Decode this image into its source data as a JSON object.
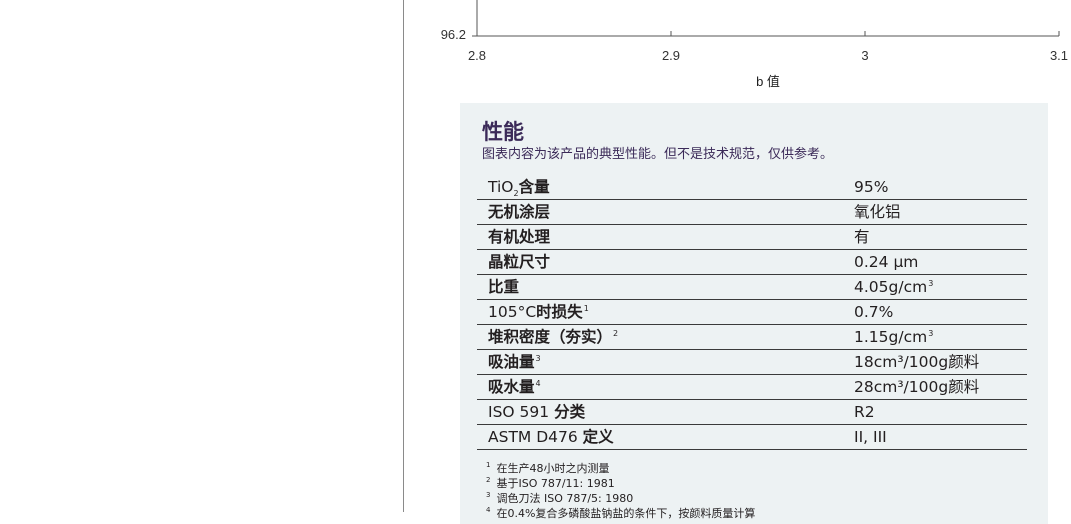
{
  "chart_data": {
    "type": "line",
    "xlabel": "b 值",
    "x_ticks": [
      "2.8",
      "2.9",
      "3",
      "3.1"
    ],
    "xlim": [
      2.8,
      3.1
    ],
    "y_ticks_visible": [
      "96.2"
    ],
    "series": []
  },
  "panel": {
    "title": "性能",
    "subtitle": "图表内容为该产品的典型性能。但不是技术规范，仅供参考。"
  },
  "properties": [
    {
      "name_a": "TiO",
      "sub": "2",
      "name_b": "含量",
      "sup": "",
      "value": "95%",
      "value_sup": ""
    },
    {
      "name_a": "",
      "sub": "",
      "name_b": "无机涂层",
      "sup": "",
      "value": "氧化铝",
      "value_sup": ""
    },
    {
      "name_a": "",
      "sub": "",
      "name_b": "有机处理",
      "sup": "",
      "value": "有",
      "value_sup": ""
    },
    {
      "name_a": "",
      "sub": "",
      "name_b": "晶粒尺寸",
      "sup": "",
      "value": "0.24 μm",
      "value_sup": ""
    },
    {
      "name_a": "",
      "sub": "",
      "name_b": "比重",
      "sup": "",
      "value": "4.05g/cm",
      "value_sup": "3"
    },
    {
      "name_a": "105°C",
      "sub": "",
      "name_b": "时损失",
      "sup": "1",
      "value": "0.7%",
      "value_sup": ""
    },
    {
      "name_a": "",
      "sub": "",
      "name_b": "堆积密度（夯实）",
      "sup": "2",
      "value": "1.15g/cm",
      "value_sup": "3"
    },
    {
      "name_a": "",
      "sub": "",
      "name_b": "吸油量",
      "sup": "3",
      "value": "18cm³/100g颜料",
      "value_sup": ""
    },
    {
      "name_a": "",
      "sub": "",
      "name_b": "吸水量",
      "sup": "4",
      "value": "28cm³/100g颜料",
      "value_sup": ""
    },
    {
      "name_a": "ISO 591 ",
      "sub": "",
      "name_b": "分类",
      "sup": "",
      "value": "R2",
      "value_sup": ""
    },
    {
      "name_a": "ASTM D476 ",
      "sub": "",
      "name_b": "定义",
      "sup": "",
      "value": "II,  III",
      "value_sup": ""
    }
  ],
  "footnotes": [
    {
      "num": "1",
      "text": "在生产48小时之内测量"
    },
    {
      "num": "2",
      "text": "基于ISO 787/11: 1981"
    },
    {
      "num": "3",
      "text": "调色刀法 ISO 787/5: 1980"
    },
    {
      "num": "4",
      "text": "在0.4%复合多磷酸盐钠盐的条件下，按颜料质量计算"
    }
  ]
}
